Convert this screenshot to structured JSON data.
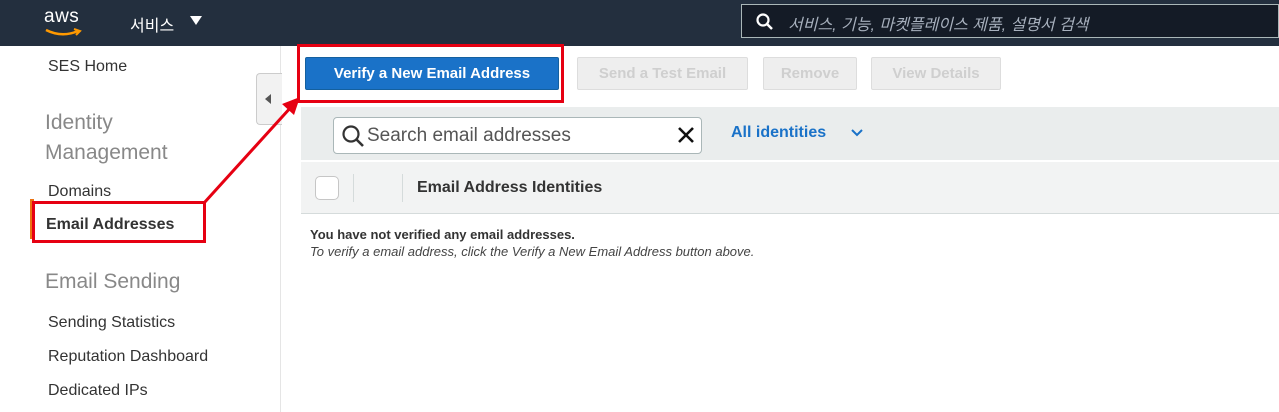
{
  "topbar": {
    "logo_text": "aws",
    "services_label": "서비스",
    "search_placeholder": "서비스, 기능, 마켓플레이스 제품, 설명서 검색"
  },
  "sidebar": {
    "home": "SES Home",
    "section1": "Identity Management",
    "domains": "Domains",
    "email_addresses": "Email Addresses",
    "section2": "Email Sending",
    "items": [
      "Sending Statistics",
      "Reputation Dashboard",
      "Dedicated IPs"
    ]
  },
  "toolbar": {
    "verify": "Verify a New Email Address",
    "send_test": "Send a Test Email",
    "remove": "Remove",
    "view_details": "View Details"
  },
  "filter": {
    "placeholder": "Search email addresses",
    "scope": "All identities"
  },
  "table": {
    "header": "Email Address Identities",
    "empty_title": "You have not verified any email addresses.",
    "empty_hint": "To verify a email address, click the Verify a New Email Address button above."
  },
  "colors": {
    "nav_bg": "#232f3e",
    "primary": "#1a72c8",
    "accent": "#ec7211",
    "annotation": "#e60012"
  }
}
